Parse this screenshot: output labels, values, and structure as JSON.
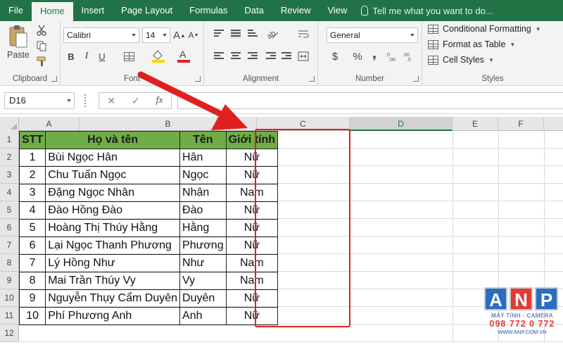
{
  "tabs": [
    "File",
    "Home",
    "Insert",
    "Page Layout",
    "Formulas",
    "Data",
    "Review",
    "View"
  ],
  "active_tab": "Home",
  "tell_me": "Tell me what you want to do...",
  "ribbon": {
    "clipboard": {
      "paste_label": "Paste",
      "group_label": "Clipboard"
    },
    "font": {
      "font_name": "Calibri",
      "font_size": "14",
      "bold": "B",
      "italic": "I",
      "underline": "U",
      "grow": "A",
      "shrink": "A",
      "group_label": "Font",
      "font_color": "#e02020",
      "fill_color": "#ffd400"
    },
    "alignment": {
      "group_label": "Alignment"
    },
    "number": {
      "format": "General",
      "currency": "$",
      "percent": "%",
      "group_label": "Number"
    },
    "styles": {
      "conditional": "Conditional Formatting",
      "format_table": "Format as Table",
      "cell_styles": "Cell Styles",
      "group_label": "Styles"
    }
  },
  "formula_bar": {
    "name_box": "D16",
    "fx": "fx",
    "cancel": "✕",
    "enter": "✓",
    "formula": ""
  },
  "columns": [
    "A",
    "B",
    "C",
    "D",
    "E",
    "F"
  ],
  "selected_column": "D",
  "rows": [
    "1",
    "2",
    "3",
    "4",
    "5",
    "6",
    "7",
    "8",
    "9",
    "10",
    "11",
    "12"
  ],
  "table": {
    "headers": [
      "STT",
      "Họ và tên",
      "Tên",
      "Giới tính"
    ],
    "header_color": "#70ad47",
    "rows": [
      [
        "1",
        "Bùi Ngọc Hân",
        "Hân",
        "Nữ"
      ],
      [
        "2",
        "Chu Tuấn Ngọc",
        "Ngọc",
        "Nữ"
      ],
      [
        "3",
        "Đặng Ngọc Nhân",
        "Nhân",
        "Nam"
      ],
      [
        "4",
        "Đào Hồng Đào",
        "Đào",
        "Nữ"
      ],
      [
        "5",
        "Hoàng Thị Thúy Hằng",
        "Hằng",
        "Nữ"
      ],
      [
        "6",
        "Lại Ngọc Thanh Phương",
        "Phương",
        "Nữ"
      ],
      [
        "7",
        "Lý Hồng Như",
        "Như",
        "Nam"
      ],
      [
        "8",
        "Mai Trần Thúy Vy",
        "Vy",
        "Nam"
      ],
      [
        "9",
        "Nguyễn Thụy Cẩm Duyên",
        "Duyên",
        "Nữ"
      ],
      [
        "10",
        "Phí Phương Anh",
        "Anh",
        "Nữ"
      ]
    ]
  },
  "annotation_color": "#e02020",
  "logo": {
    "letters": [
      "A",
      "N",
      "P"
    ],
    "letter_colors": [
      "#2b6cc4",
      "#e53935",
      "#2b6cc4"
    ],
    "subtitle": "MÁY TÍNH - CAMERA",
    "phone": "098 772 0 772",
    "website": "WWW.ANP.COM.VN"
  }
}
